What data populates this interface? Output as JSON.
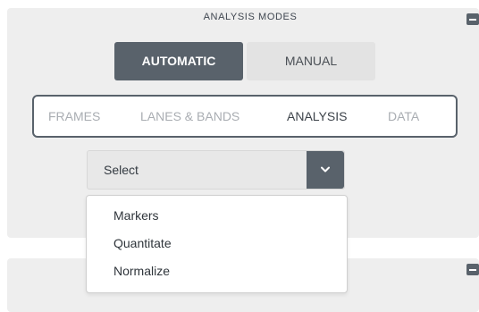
{
  "panel": {
    "title": "ANALYSIS MODES",
    "collapse_icon": "minus-icon"
  },
  "modes": {
    "automatic": "AUTOMATIC",
    "manual": "MANUAL",
    "selected": "AUTOMATIC"
  },
  "tabs": {
    "items": [
      "FRAMES",
      "LANES & BANDS",
      "ANALYSIS",
      "DATA"
    ],
    "active": "ANALYSIS"
  },
  "select": {
    "value": "Select",
    "arrow_icon": "chevron-down-icon"
  },
  "dropdown": {
    "options": [
      "Markers",
      "Quantitate",
      "Normalize"
    ]
  },
  "colors": {
    "accent": "#59626b",
    "panel_bg": "#eeeeee"
  }
}
